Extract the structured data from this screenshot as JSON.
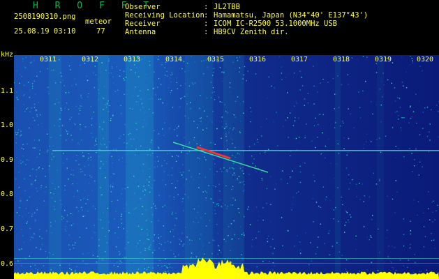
{
  "header": {
    "brand": "H R O F F T",
    "filename": "2508190310.png",
    "mode": "meteor",
    "datetime": "25.08.19 03:10",
    "count": "77",
    "fields": [
      {
        "label": "Observer",
        "value": "JL2TBB"
      },
      {
        "label": "Receiving Location",
        "value": "Hamamatsu, Japan (N34°40' E137°43')"
      },
      {
        "label": "Receiver",
        "value": "ICOM IC-R2500 53.1000MHz USB"
      },
      {
        "label": "Antenna",
        "value": "HB9CV Zenith dir."
      }
    ],
    "separator": ":"
  },
  "axis": {
    "y_unit": "kHz",
    "x_ticks": [
      "0311",
      "0312",
      "0313",
      "0314",
      "0315",
      "0316",
      "0317",
      "0318",
      "0319",
      "0320"
    ],
    "y_ticks": [
      "1.1",
      "1.0",
      "0.9",
      "0.8",
      "0.7",
      "0.6"
    ]
  },
  "colors": {
    "background": "#000000",
    "label": "#ffff3a",
    "brand": "#16b04a",
    "noise_low": "#0a1a7a",
    "noise_high": "#1fd0c8",
    "carrier": "#3ed8c8",
    "meteor": "#ff3030",
    "spectrum": "#ffff00"
  }
}
